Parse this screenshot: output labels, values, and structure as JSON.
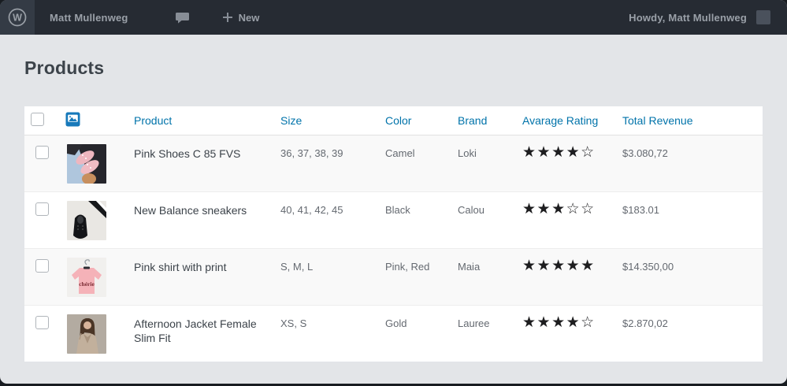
{
  "admin_bar": {
    "site_user": "Matt Mullenweg",
    "new_label": "New",
    "howdy_text": "Howdy, Matt Mullenweg"
  },
  "page": {
    "title": "Products"
  },
  "table": {
    "headers": {
      "product": "Product",
      "size": "Size",
      "color": "Color",
      "brand": "Brand",
      "rating": "Avarage Rating",
      "revenue": "Total Revenue"
    },
    "rating_max": 5,
    "rows": [
      {
        "image": "pink-shoes-photo",
        "product": "Pink Shoes C 85 FVS",
        "size": "36, 37, 38, 39",
        "color": "Camel",
        "brand": "Loki",
        "rating": 4,
        "revenue": "$3.080,72"
      },
      {
        "image": "black-sneakers-photo",
        "product": "New Balance sneakers",
        "size": "40, 41, 42, 45",
        "color": "Black",
        "brand": "Calou",
        "rating": 3,
        "revenue": "$183.01"
      },
      {
        "image": "pink-shirt-photo",
        "image_text": "chérie",
        "product": "Pink shirt with print",
        "size": "S, M, L",
        "color": "Pink, Red",
        "brand": "Maia",
        "rating": 5,
        "revenue": "$14.350,00"
      },
      {
        "image": "female-jacket-photo",
        "product": "Afternoon Jacket Female Slim Fit",
        "size": "XS, S",
        "color": "Gold",
        "brand": "Lauree",
        "rating": 4,
        "revenue": "$2.870,02"
      }
    ]
  },
  "colors": {
    "admin_bar_bg": "#262b33",
    "page_bg": "#e3e5e8",
    "link_blue": "#0073aa",
    "star": "#1d1d1f"
  }
}
